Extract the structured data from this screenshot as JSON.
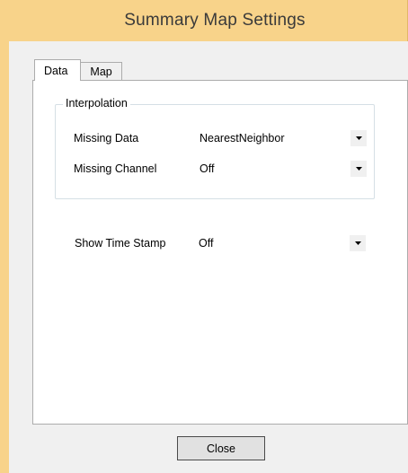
{
  "window": {
    "title": "Summary  Map Settings"
  },
  "tabs": [
    {
      "label": "Data",
      "active": true
    },
    {
      "label": "Map",
      "active": false
    }
  ],
  "interpolation": {
    "group_title": "Interpolation",
    "missing_data": {
      "label": "Missing Data",
      "value": "NearestNeighbor"
    },
    "missing_channel": {
      "label": "Missing Channel",
      "value": "Off"
    }
  },
  "show_time_stamp": {
    "label": "Show Time Stamp",
    "value": "Off"
  },
  "buttons": {
    "close_label": "Close"
  },
  "colors": {
    "frame": "#f8d38a",
    "client": "#f0f0f0"
  },
  "icons": {
    "dropdown": "chevron-down-icon"
  }
}
